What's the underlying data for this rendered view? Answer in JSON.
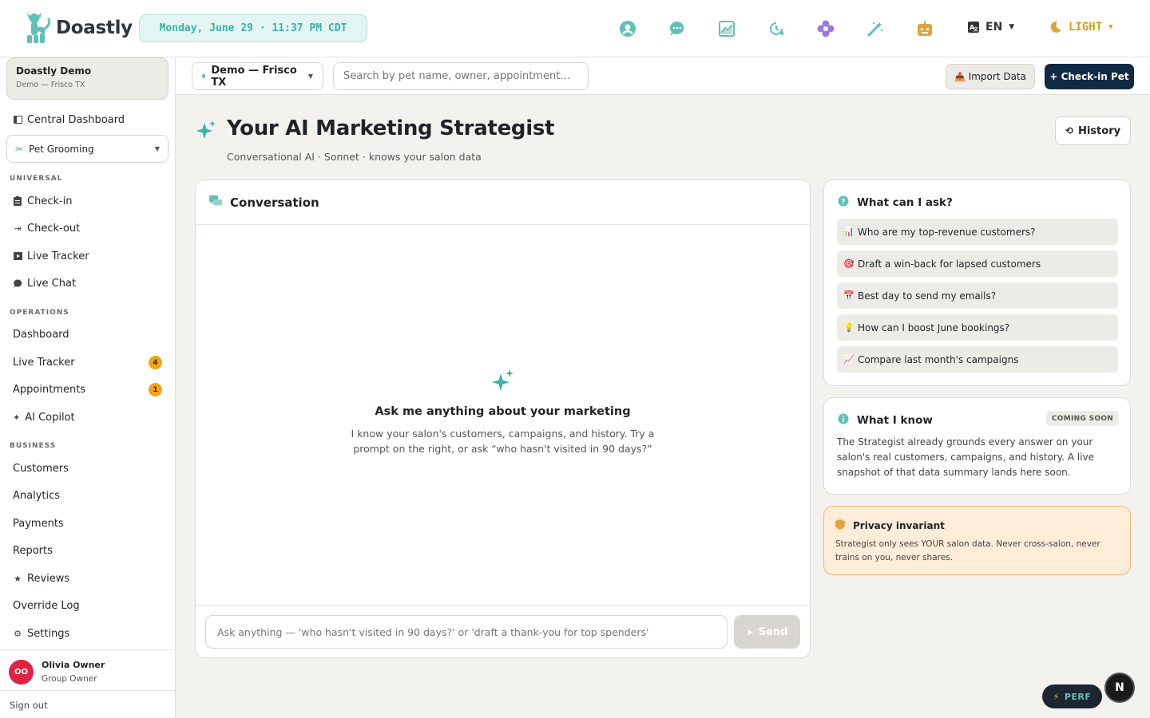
{
  "app": {
    "name": "Doastly"
  },
  "topbar": {
    "clock": "Monday, June 29 · 11:37 PM CDT",
    "lang": "EN",
    "theme": "LIGHT",
    "icons": [
      "account-icon",
      "chat-icon",
      "chart-icon",
      "clock-history-icon",
      "flower-icon",
      "magic-wand-icon",
      "robot-icon"
    ]
  },
  "sidebar": {
    "org_name": "Doastly Demo",
    "org_location": "Demo — Frisco TX",
    "central_dashboard": "Central Dashboard",
    "module_select": "Pet Grooming",
    "sections": {
      "universal": "UNIVERSAL",
      "operations": "OPERATIONS",
      "business": "BUSINESS"
    },
    "universal_items": [
      "Check-in",
      "Check-out",
      "Live Tracker",
      "Live Chat"
    ],
    "operations_items": [
      "Dashboard",
      "Live Tracker",
      "Appointments",
      "AI Copilot"
    ],
    "operations_badges": {
      "live_tracker": "4",
      "appointments": "1"
    },
    "business_items": [
      "Customers",
      "Analytics",
      "Payments",
      "Reports",
      "Reviews",
      "Override Log",
      "Settings"
    ],
    "user": {
      "initials": "OO",
      "name": "Olivia Owner",
      "role": "Group Owner"
    },
    "sign_out": "Sign out"
  },
  "subbar": {
    "location": "Demo — Frisco TX",
    "search_placeholder": "Search by pet name, owner, appointment…",
    "import_label": "Import Data",
    "checkin_label": "+ Check-in Pet"
  },
  "page": {
    "title": "Your AI Marketing Strategist",
    "subtitle": "Conversational AI · Sonnet · knows your salon data",
    "history_label": "History"
  },
  "conversation": {
    "title": "Conversation",
    "empty_title": "Ask me anything about your marketing",
    "empty_text": "I know your salon's customers, campaigns, and history. Try a prompt on the right, or ask “who hasn't visited in 90 days?”",
    "input_placeholder": "Ask anything — 'who hasn't visited in 90 days?' or 'draft a thank-you for top spenders'",
    "send_label": "Send"
  },
  "ask_card": {
    "title": "What can I ask?",
    "prompts": [
      {
        "emoji": "📊",
        "text": "Who are my top-revenue customers?"
      },
      {
        "emoji": "🎯",
        "text": "Draft a win-back for lapsed customers"
      },
      {
        "emoji": "📅",
        "text": "Best day to send my emails?"
      },
      {
        "emoji": "💡",
        "text": "How can I boost June bookings?"
      },
      {
        "emoji": "📈",
        "text": "Compare last month's campaigns"
      }
    ]
  },
  "know_card": {
    "title": "What I know",
    "badge": "COMING SOON",
    "text": "The Strategist already grounds every answer on your salon's real customers, campaigns, and history. A live snapshot of that data summary lands here soon."
  },
  "privacy_card": {
    "title": "Privacy invariant",
    "text": "Strategist only sees YOUR salon data. Never cross-salon, never trains on you, never shares."
  },
  "floating": {
    "perf_label": "PERF",
    "n_label": "N"
  },
  "colors": {
    "teal": "#3ab3a8",
    "navy": "#102a43",
    "orange_badge": "#f0a418",
    "avatar": "#e0213f",
    "privacy_bg": "#fdecd8"
  }
}
